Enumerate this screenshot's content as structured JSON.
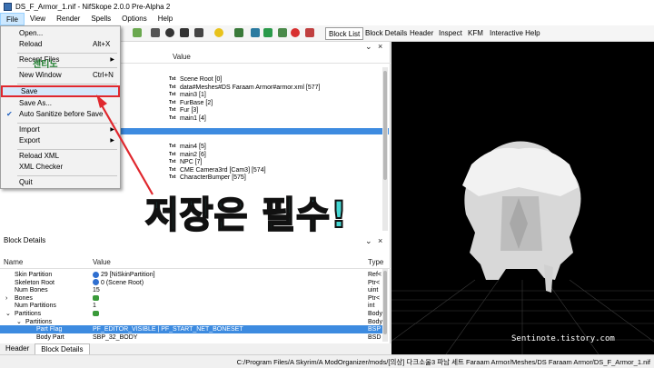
{
  "window": {
    "title": "DS_F_Armor_1.nif - NifSkope 2.0.0 Pre-Alpha 2"
  },
  "menu": [
    "File",
    "View",
    "Render",
    "Spells",
    "Options",
    "Help"
  ],
  "toolbar": {
    "buttons": [
      "Block List",
      "Block Details",
      "Header",
      "Inspect",
      "KFM",
      "Interactive Help"
    ]
  },
  "file_menu": {
    "items": [
      {
        "label": "Open...",
        "shortcut": ""
      },
      {
        "label": "Reload",
        "shortcut": "Alt+X"
      },
      {
        "label": "Recent Files",
        "shortcut": ""
      },
      {
        "label": "New Window",
        "shortcut": "Ctrl+N"
      },
      {
        "label": "Save",
        "shortcut": ""
      },
      {
        "label": "Save As...",
        "shortcut": ""
      },
      {
        "label": "Auto Sanitize before Save",
        "shortcut": ""
      },
      {
        "label": "Import",
        "shortcut": ""
      },
      {
        "label": "Export",
        "shortcut": ""
      },
      {
        "label": "Reload XML",
        "shortcut": ""
      },
      {
        "label": "XML Checker",
        "shortcut": ""
      },
      {
        "label": "Quit",
        "shortcut": ""
      }
    ]
  },
  "block_list": {
    "value_header": "Value",
    "txt_badge": "Txt",
    "values_top": [
      "Scene Root [0]",
      "data#Meshes#DS Faraam Armor#armor.xml [577]",
      "main3 [1]",
      "FurBase [2]",
      "Fur [3]",
      "main1 [4]"
    ],
    "values_bottom": [
      "main4 [5]",
      "main2 [6]",
      "NPC [7]",
      "CME Camera3rd [Cam3] [574]",
      "CharacterBumper [575]"
    ]
  },
  "block_details": {
    "title": "Block Details",
    "headers": {
      "name": "Name",
      "value": "Value",
      "type": "Type"
    },
    "rows": [
      {
        "name": "Skin Partition",
        "value": "29 [NiSkinPartition]",
        "type": "Ref<"
      },
      {
        "name": "Skeleton Root",
        "value": "0 (Scene Root)",
        "type": "Ptr<"
      },
      {
        "name": "Num Bones",
        "value": "15",
        "type": "uint"
      },
      {
        "name": "Bones",
        "value": "",
        "type": "Ptr<"
      },
      {
        "name": "Num Partitions",
        "value": "1",
        "type": "int"
      },
      {
        "name": "Partitions",
        "value": "",
        "type": "Body"
      },
      {
        "name": "Partitions",
        "value": "",
        "type": "Body"
      },
      {
        "name": "Part Flag",
        "value": "PF_EDITOR_VISIBLE | PF_START_NET_BONESET",
        "type": "BSP"
      },
      {
        "name": "Body Part",
        "value": "SBP_32_BODY",
        "type": "BSD"
      }
    ]
  },
  "tabs": [
    "Header",
    "Block Details"
  ],
  "status": {
    "path": "C:/Program Files/A Skyrim/A ModOrganizer/mods/[의상] 다크소울3 파남 세트 Faraam Armor/Meshes/DS Faraam Armor/DS_F_Armor_1.nif"
  },
  "watermark": "Sentinote.tistory.com",
  "logo_text": "센티노",
  "overlay_caption": "저장은 필수!",
  "colors": {
    "highlight": "#3d8be0",
    "callout_red": "#e0282e",
    "caption_fill": "#46d7d3"
  }
}
